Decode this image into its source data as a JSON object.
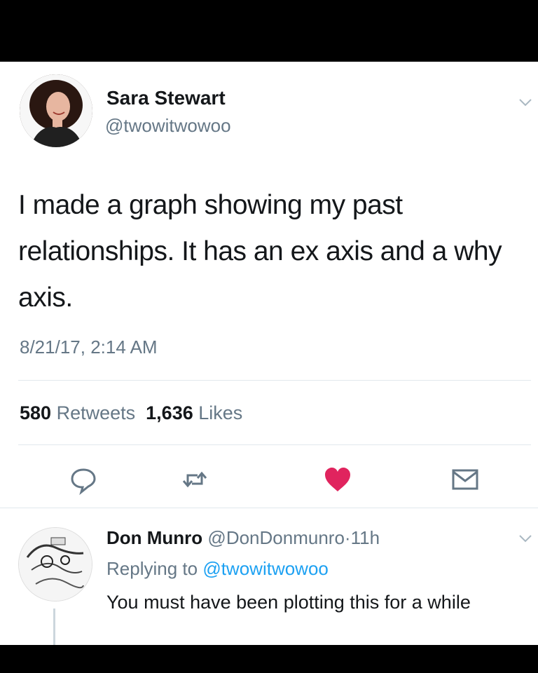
{
  "tweet": {
    "author_name": "Sara Stewart",
    "author_handle": "@twowitwowoo",
    "text": "I made a graph showing my past relationships. It has an ex axis and a why axis.",
    "timestamp": "8/21/17, 2:14 AM",
    "retweets_count": "580",
    "retweets_label": "Retweets",
    "likes_count": "1,636",
    "likes_label": "Likes",
    "icons": {
      "avatar": "profile-photo",
      "menu": "chevron-down-icon",
      "reply": "reply-icon",
      "retweet": "retweet-icon",
      "like": "heart-icon",
      "message": "mail-icon"
    },
    "colors": {
      "like_active": "#e0245e",
      "muted_text": "#657786",
      "link": "#1da1f2"
    }
  },
  "reply": {
    "author_name": "Don Munro",
    "author_handle": "@DonDonmunro",
    "separator": "·",
    "time_ago": "11h",
    "replying_label": "Replying to",
    "replying_mention": "@twowitwowoo",
    "text": "You must have been plotting this for a while"
  }
}
